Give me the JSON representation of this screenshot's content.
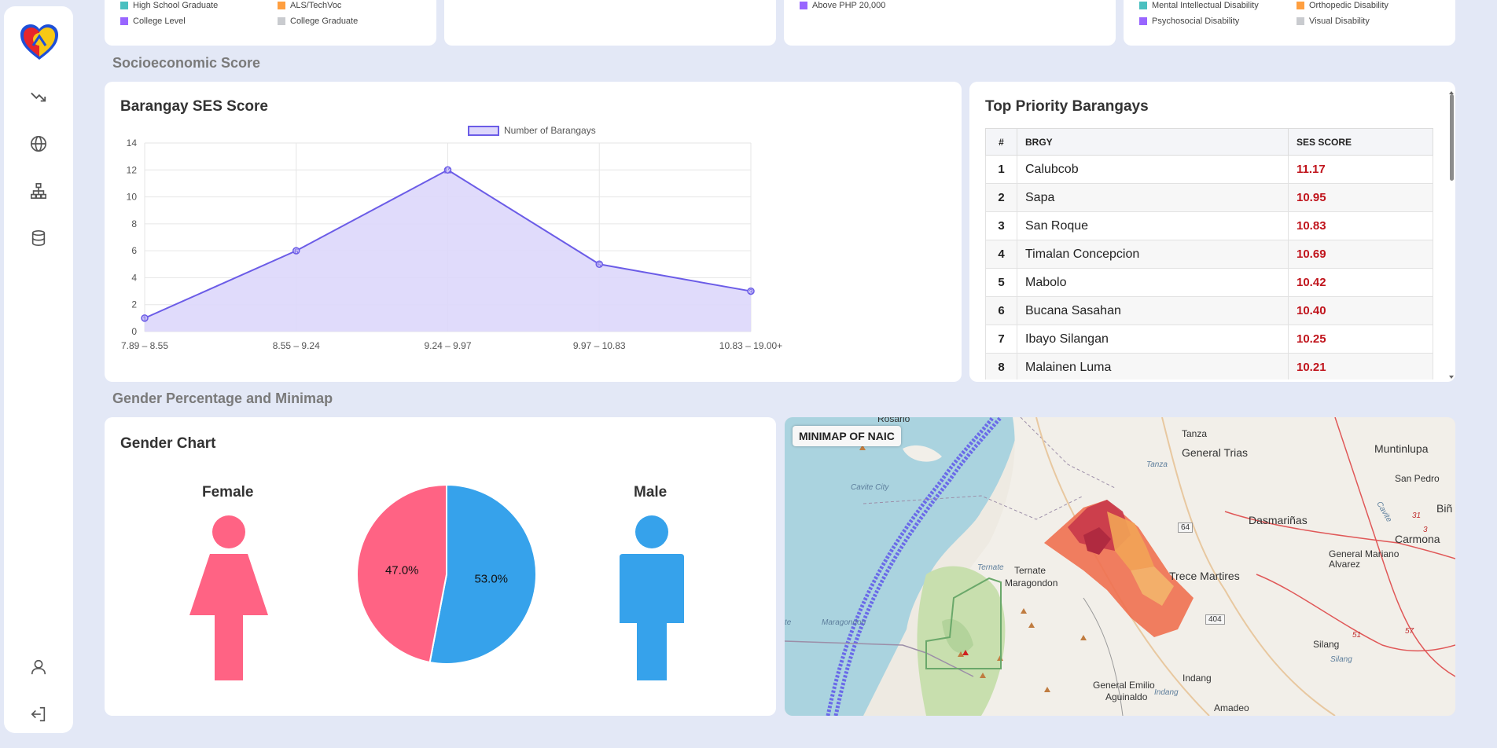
{
  "sections": {
    "ses": "Socioeconomic Score",
    "gender": "Gender Percentage and Minimap"
  },
  "top_legends": {
    "education": [
      {
        "label": "High School Graduate",
        "color": "#4bc0c0"
      },
      {
        "label": "ALS/TechVoc",
        "color": "#ff9f40"
      },
      {
        "label": "College Level",
        "color": "#9966ff"
      },
      {
        "label": "College Graduate",
        "color": "#c9cbcf"
      }
    ],
    "income": [
      {
        "label": "Above PHP 20,000",
        "color": "#9966ff"
      }
    ],
    "disability": [
      {
        "label": "Mental Intellectual Disability",
        "color": "#4bc0c0"
      },
      {
        "label": "Orthopedic Disability",
        "color": "#ff9f40"
      },
      {
        "label": "Psychosocial Disability",
        "color": "#9966ff"
      },
      {
        "label": "Visual Disability",
        "color": "#c9cbcf"
      }
    ]
  },
  "ses_card": {
    "title": "Barangay SES Score",
    "legend": "Number of Barangays"
  },
  "chart_data": {
    "type": "area",
    "title": "Barangay SES Score",
    "categories": [
      "7.89 – 8.55",
      "8.55 – 9.24",
      "9.24 – 9.97",
      "9.97 – 10.83",
      "10.83 – 19.00+"
    ],
    "series": [
      {
        "name": "Number of Barangays",
        "values": [
          1,
          6,
          12,
          5,
          3
        ]
      }
    ],
    "ylim": [
      0,
      14
    ],
    "yticks": [
      0,
      2,
      4,
      6,
      8,
      10,
      12,
      14
    ],
    "grid": true,
    "legend": "top-center",
    "colors": {
      "line": "#6b5ce7",
      "fill": "#ddd7fb"
    }
  },
  "priority": {
    "title": "Top Priority Barangays",
    "headers": [
      "#",
      "BRGY",
      "SES SCORE"
    ],
    "rows": [
      {
        "rank": "1",
        "name": "Calubcob",
        "score": "11.17"
      },
      {
        "rank": "2",
        "name": "Sapa",
        "score": "10.95"
      },
      {
        "rank": "3",
        "name": "San Roque",
        "score": "10.83"
      },
      {
        "rank": "4",
        "name": "Timalan Concepcion",
        "score": "10.69"
      },
      {
        "rank": "5",
        "name": "Mabolo",
        "score": "10.42"
      },
      {
        "rank": "6",
        "name": "Bucana Sasahan",
        "score": "10.40"
      },
      {
        "rank": "7",
        "name": "Ibayo Silangan",
        "score": "10.25"
      },
      {
        "rank": "8",
        "name": "Malainen Luma",
        "score": "10.21"
      }
    ]
  },
  "gender": {
    "title": "Gender Chart",
    "female_label": "Female",
    "male_label": "Male",
    "female_pct": 47.0,
    "male_pct": 53.0,
    "female_text": "47.0%",
    "male_text": "53.0%",
    "female_color": "#ff6384",
    "male_color": "#36a2eb"
  },
  "minimap": {
    "title": "MINIMAP OF NAIC",
    "labels": {
      "rosario": "Rosario",
      "tanza": "Tanza",
      "general_trias": "General Trias",
      "muntinlupa": "Muntinlupa",
      "san_pedro": "San Pedro",
      "binan": "Biñ",
      "dasmarinas": "Dasmariñas",
      "carmona": "Carmona",
      "general_mariano_alvarez": "General Mariano Alvarez",
      "cavite_city": "Cavite City",
      "ternate": "Ternate",
      "ternate_river": "Ternate",
      "maragondon": "Maragondon",
      "maragondon_river": "Maragondon",
      "trece_martires": "Trece Martires",
      "silang": "Silang",
      "silang_river": "Silang",
      "indang": "Indang",
      "indang_river": "Indang",
      "general_emilio": "General Emilio",
      "aguinaldo": "Aguinaldo",
      "amadeo": "Amadeo",
      "tanza_river": "Tanza",
      "cavite_river": "Cavite",
      "te": "te",
      "rt64": "64",
      "rt404": "404",
      "rt51": "51",
      "rt57": "57",
      "rt31": "31",
      "rt3": "3"
    }
  }
}
